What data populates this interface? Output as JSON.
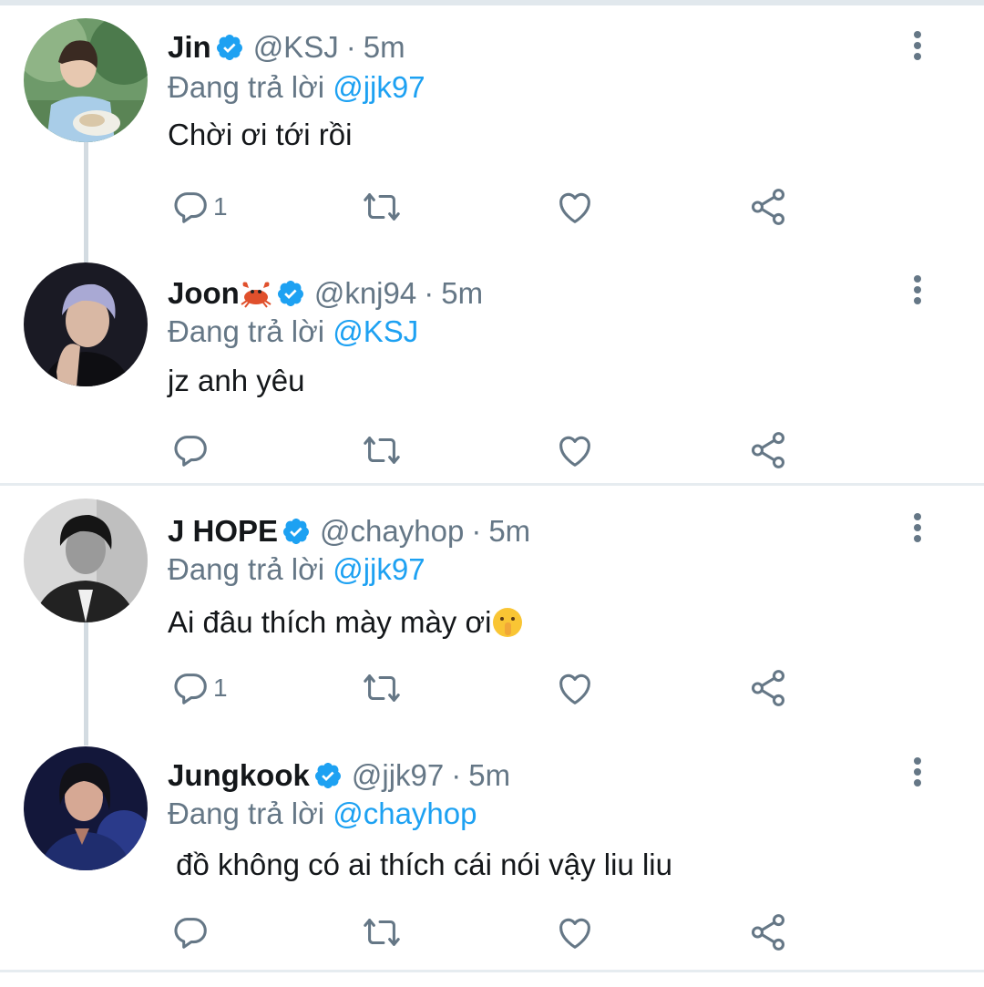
{
  "colors": {
    "accent": "#1da1f2",
    "muted": "#657786",
    "text": "#14171a",
    "divider": "#e6ecf0"
  },
  "tweets": [
    {
      "name": "Jin",
      "handle": "@KSJ",
      "time": "5m",
      "replying_label": "Đang trả lời",
      "reply_to": "@jjk97",
      "text": "Chời ơi tới rồi",
      "reply_count": "1",
      "name_emoji": "",
      "text_emoji": ""
    },
    {
      "name": "Joon",
      "handle": "@knj94",
      "time": "5m",
      "replying_label": "Đang trả lời",
      "reply_to": "@KSJ",
      "text": "jz anh yêu",
      "reply_count": "",
      "name_emoji": "crab-emoji",
      "text_emoji": ""
    },
    {
      "name": "J HOPE",
      "handle": "@chayhop",
      "time": "5m",
      "replying_label": "Đang trả lời",
      "reply_to": "@jjk97",
      "text": "Ai đâu thích mày mày ơi",
      "reply_count": "1",
      "name_emoji": "",
      "text_emoji": "shushing-face-emoji"
    },
    {
      "name": "Jungkook",
      "handle": "@jjk97",
      "time": "5m",
      "replying_label": "Đang trả lời",
      "reply_to": "@chayhop",
      "text": " đồ không có ai thích cái nói vậy liu liu",
      "reply_count": "",
      "name_emoji": "",
      "text_emoji": ""
    }
  ],
  "separator": "·",
  "icons": [
    "verified-badge-icon",
    "more-vertical-icon",
    "reply-icon",
    "retweet-icon",
    "like-icon",
    "share-icon"
  ]
}
